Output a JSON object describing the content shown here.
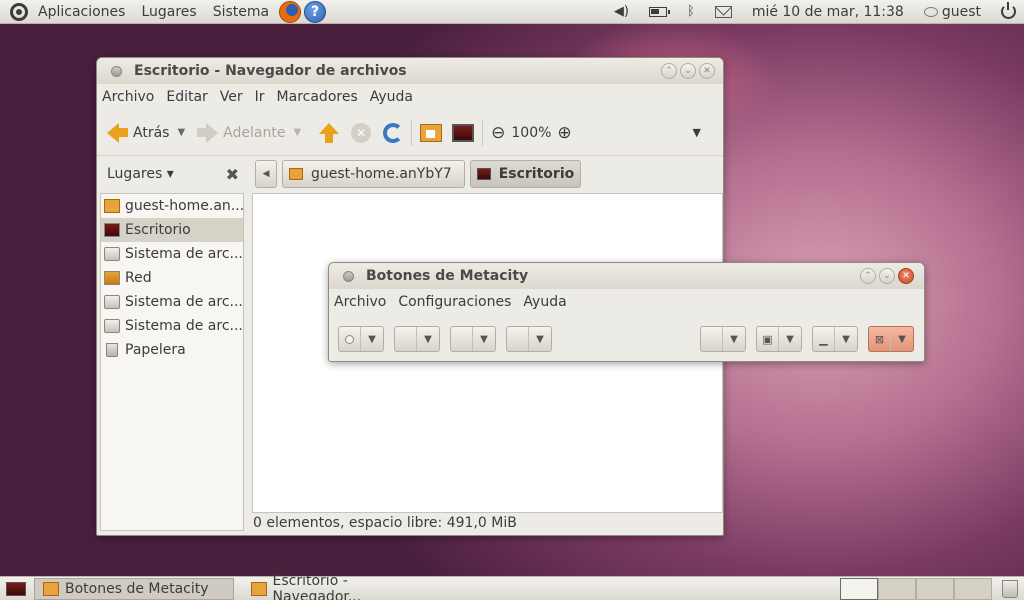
{
  "top_panel": {
    "menus": [
      "Aplicaciones",
      "Lugares",
      "Sistema"
    ],
    "clock": "mié 10 de mar, 11:38",
    "user": "guest"
  },
  "nautilus": {
    "title": "Escritorio - Navegador de archivos",
    "menu": [
      "Archivo",
      "Editar",
      "Ver",
      "Ir",
      "Marcadores",
      "Ayuda"
    ],
    "toolbar": {
      "back": "Atrás",
      "forward": "Adelante",
      "zoom": "100%"
    },
    "sidebar_header": "Lugares",
    "sidebar_items": [
      {
        "label": "guest-home.an...",
        "icon": "home-folder-icon"
      },
      {
        "label": "Escritorio",
        "icon": "desktop-icon"
      },
      {
        "label": "Sistema de arc...",
        "icon": "drive-icon"
      },
      {
        "label": "Red",
        "icon": "network-icon"
      },
      {
        "label": "Sistema de arc...",
        "icon": "drive-icon"
      },
      {
        "label": "Sistema de arc...",
        "icon": "drive-icon"
      },
      {
        "label": "Papelera",
        "icon": "trash-icon"
      }
    ],
    "path": [
      "guest-home.anYbY7",
      "Escritorio"
    ],
    "status": "0 elementos, espacio libre: 491,0 MiB"
  },
  "metacity": {
    "title": "Botones de Metacity",
    "menu": [
      "Archivo",
      "Configuraciones",
      "Ayuda"
    ]
  },
  "taskbar": {
    "tasks": [
      "Botones de Metacity",
      "Escritorio - Navegador..."
    ]
  },
  "colors": {
    "panel": "#dcd9d2",
    "accent_orange": "#e9a21a",
    "close_red": "#c94a2a"
  }
}
